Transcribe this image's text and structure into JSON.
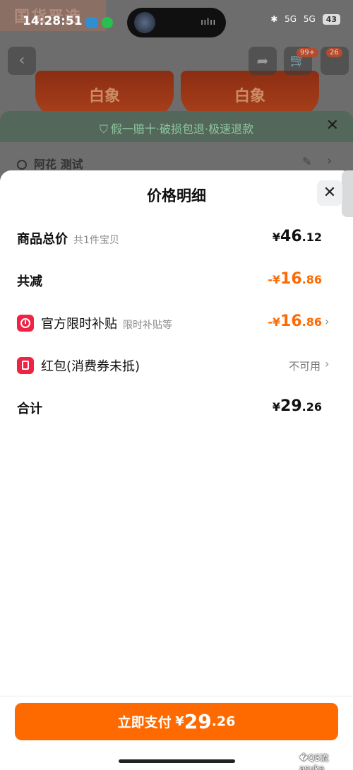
{
  "status_bar": {
    "time": "14:28:51",
    "network1": "5G",
    "network2": "5G",
    "battery": "43"
  },
  "background": {
    "brand": "国货严选",
    "product_label": "白象",
    "cart_badge": "99+",
    "more_badge": "26",
    "guarantee": "假一赔十·破损包退·极速退款",
    "address": "阿花 测试"
  },
  "sheet": {
    "title": "价格明细",
    "rows": [
      {
        "label": "商品总价",
        "hint": "共1件宝贝",
        "yen": "¥",
        "int": "46",
        "dec": ".12"
      },
      {
        "label": "共减",
        "prefix": "-¥",
        "int": "16",
        "dec": ".86"
      },
      {
        "label": "官方限时补贴",
        "hint": "限时补贴等",
        "prefix": "-¥",
        "int": "16",
        "dec": ".86"
      },
      {
        "label": "红包(消费券未抵)",
        "status": "不可用"
      },
      {
        "label": "合计",
        "yen": "¥",
        "int": "29",
        "dec": ".26"
      }
    ]
  },
  "bottom": {
    "pay_label": "立即支付",
    "yen": "¥",
    "int": "29",
    "dec": ".26",
    "watermark": "�QS流asuka"
  },
  "colors": {
    "accent": "#ff6a00",
    "tag_red": "#ee2444"
  }
}
